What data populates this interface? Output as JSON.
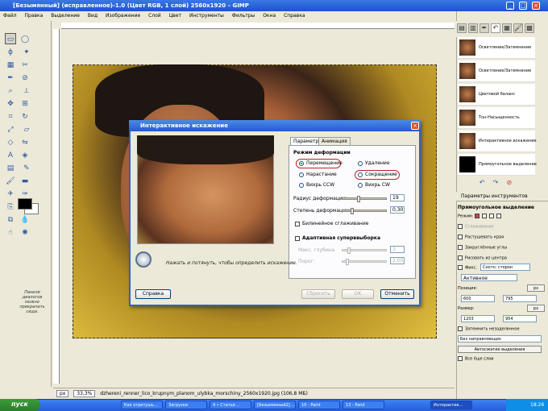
{
  "window": {
    "title": "[Безымянный] (исправленное)-1.0 (Цвет RGB, 1 слой) 2560x1920 – GIMP"
  },
  "menu": [
    "Файл",
    "Правка",
    "Выделение",
    "Вид",
    "Изображение",
    "Слой",
    "Цвет",
    "Инструменты",
    "Фильтры",
    "Окна",
    "Справка"
  ],
  "toolbox": {
    "hint": "Панели диалогов можно прикрепить сюда."
  },
  "status": {
    "unit": "px",
    "zoom": "33,3%",
    "file_info": "dzhereni_renner_lico_krupnym_planom_ulybka_morschiny_2560x1920.jpg (106,8 МБ)"
  },
  "history": [
    {
      "label": "Осветление/Затемнение"
    },
    {
      "label": "Осветление/Затемнение"
    },
    {
      "label": "Цветовой баланс"
    },
    {
      "label": "Тон-Насыщенность"
    },
    {
      "label": "Интерактивное искажение"
    },
    {
      "label": "Прямоугольное выделение"
    }
  ],
  "tool_options": {
    "tab": "Параметры инструментов",
    "title": "Прямоугольное выделение",
    "mode_label": "Режим:",
    "antialias": "Сглаживание",
    "feather": "Растушевать края",
    "rounded": "Закруглённые углы",
    "from_center": "Рисовать из центра",
    "fixed_label": "Фикс.",
    "fixed_value": "Соотн. сторон",
    "active_value": "Активное",
    "position_label": "Позиция:",
    "pos_x": "600",
    "pos_y": "795",
    "size_label": "Размер:",
    "size_w": "1203",
    "size_h": "954",
    "highlight": "Затемнить незаделенное",
    "guides": "Без направляющих",
    "autoshrink": "Автосжатие выделения",
    "merged": "Все ёще слои",
    "unit": "px"
  },
  "dialog": {
    "title": "Интерактивное искажение",
    "tabs": [
      "Параметры",
      "Анимация"
    ],
    "mode_heading": "Режим деформации",
    "modes": [
      "Перемещение",
      "Удаление",
      "Нарастание",
      "Сокращение",
      "Вихрь CCW",
      "Вихрь CW"
    ],
    "radius_label": "Радиус деформации:",
    "radius_value": "19",
    "strength_label": "Степень деформации:",
    "strength_value": "0,30",
    "bilinear": "Билинейное сглаживание",
    "adaptive": "Адаптивная суперввыборка",
    "max_depth_label": "Макс. глубина",
    "max_depth_value": "3",
    "threshold_label": "Порог:",
    "threshold_value": "2,00",
    "hint": "Нажать и потянуть, чтобы определить искажение.",
    "help_btn": "Справка",
    "reset_btn": "Сбросить",
    "ok_btn": "OK",
    "cancel_btn": "Отменить"
  },
  "taskbar": {
    "start": "пуск",
    "tasks": [
      "Как отретушь...",
      "Загрузки",
      "4 • Статья ...",
      "[Безымянный2] ...",
      "10 - Paint",
      "13 - Paint",
      "Интерактив..."
    ],
    "time": "18:26"
  }
}
